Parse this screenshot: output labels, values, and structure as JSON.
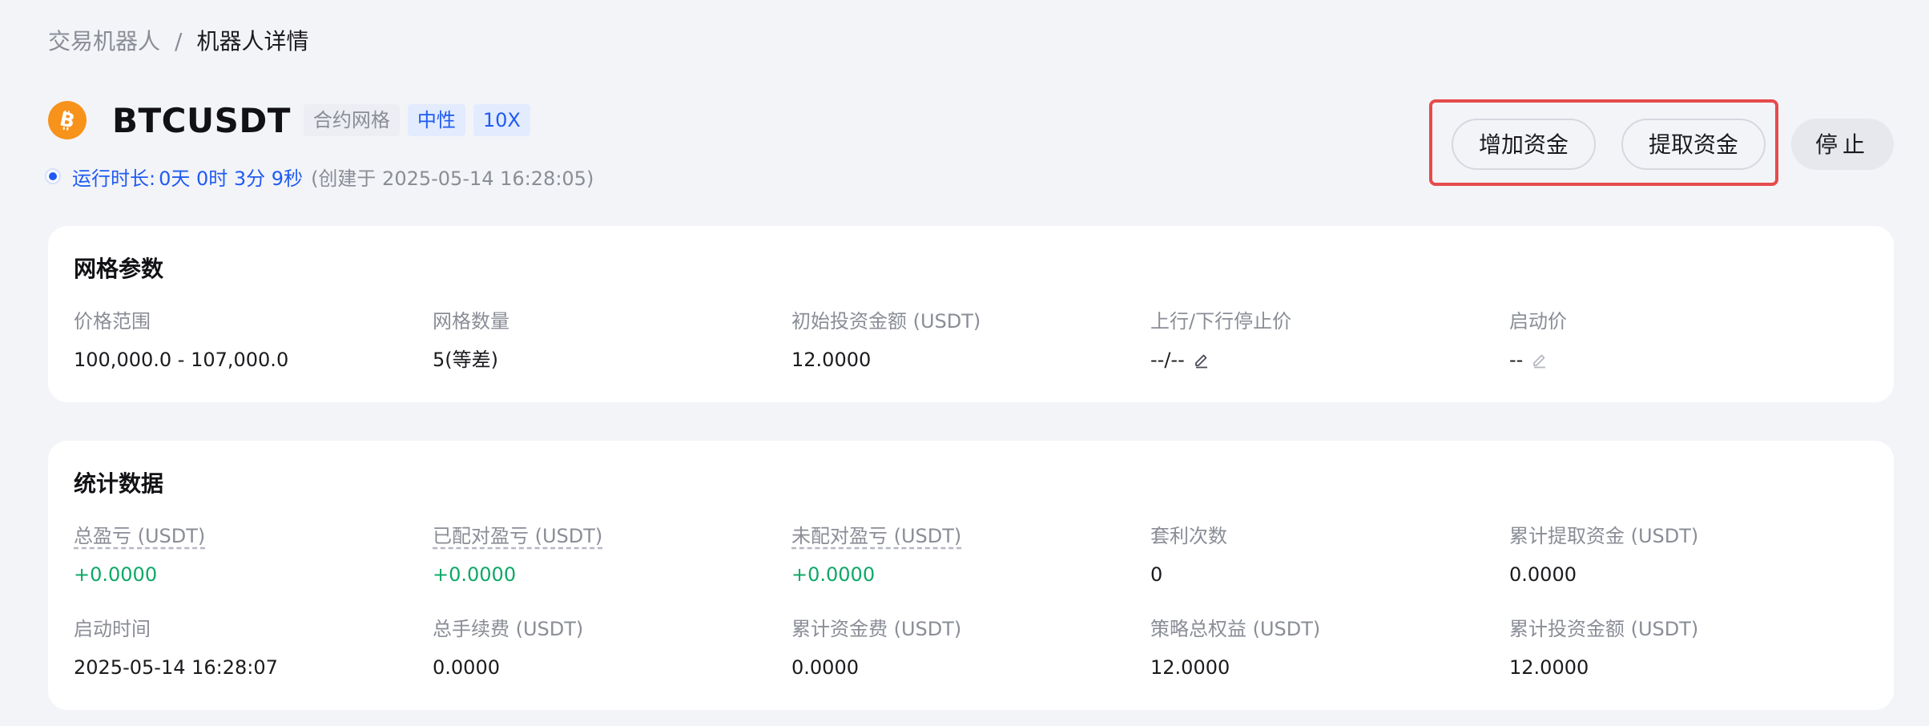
{
  "breadcrumb": {
    "root": "交易机器人",
    "separator": "/",
    "current": "机器人详情"
  },
  "header": {
    "coin_icon": "bitcoin-icon",
    "symbol": "BTCUSDT",
    "tags": {
      "type": "合约网格",
      "mode": "中性",
      "leverage": "10X"
    }
  },
  "runtime": {
    "label": "运行时长:",
    "duration": "0天 0时 3分 9秒",
    "created": "(创建于 2025-05-14 16:28:05)"
  },
  "actions": {
    "add_funds": "增加资金",
    "withdraw_funds": "提取资金",
    "stop": "停止"
  },
  "grid_params": {
    "title": "网格参数",
    "fields": [
      {
        "label": "价格范围",
        "value": "100,000.0 - 107,000.0"
      },
      {
        "label": "网格数量",
        "value": "5(等差)"
      },
      {
        "label": "初始投资金额 (USDT)",
        "value": "12.0000"
      },
      {
        "label": "上行/下行停止价",
        "value": "--/--"
      },
      {
        "label": "启动价",
        "value": "--"
      }
    ]
  },
  "stats": {
    "title": "统计数据",
    "row1": [
      {
        "label": "总盈亏 (USDT)",
        "value": "+0.0000"
      },
      {
        "label": "已配对盈亏 (USDT)",
        "value": "+0.0000"
      },
      {
        "label": "未配对盈亏 (USDT)",
        "value": "+0.0000"
      },
      {
        "label": "套利次数",
        "value": "0"
      },
      {
        "label": "累计提取资金 (USDT)",
        "value": "0.0000"
      }
    ],
    "row2": [
      {
        "label": "启动时间",
        "value": "2025-05-14 16:28:07"
      },
      {
        "label": "总手续费 (USDT)",
        "value": "0.0000"
      },
      {
        "label": "累计资金费 (USDT)",
        "value": "0.0000"
      },
      {
        "label": "策略总权益 (USDT)",
        "value": "12.0000"
      },
      {
        "label": "累计投资金额 (USDT)",
        "value": "12.0000"
      }
    ]
  },
  "colors": {
    "accent": "#1f5bf2",
    "positive": "#0ea866",
    "highlight": "#e64b4b",
    "coin": "#f7931a"
  }
}
